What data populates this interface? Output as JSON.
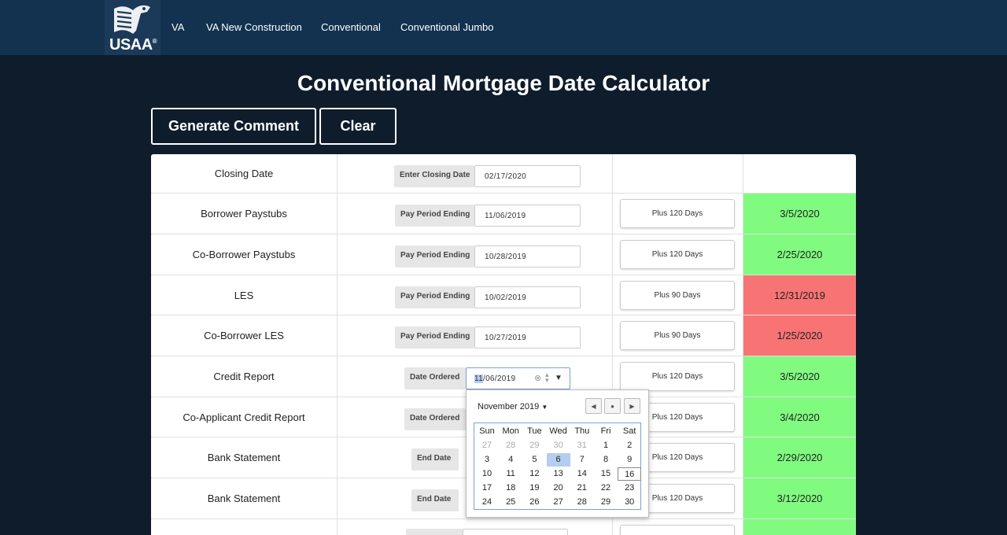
{
  "nav": {
    "logo_text": "USAA",
    "logo_mark": "®",
    "links": [
      "VA",
      "VA New Construction",
      "Conventional",
      "Conventional Jumbo"
    ]
  },
  "page": {
    "title": "Conventional Mortgage Date Calculator"
  },
  "actions": {
    "generate": "Generate Comment",
    "clear": "Clear"
  },
  "rows": [
    {
      "name": "Closing Date",
      "label": "Enter Closing Date",
      "value": "02/17/2020",
      "plus": "",
      "result": ""
    },
    {
      "name": "Borrower Paystubs",
      "label": "Pay Period Ending",
      "value": "11/06/2019",
      "plus": "Plus 120 Days",
      "result": "3/5/2020",
      "status": "green"
    },
    {
      "name": "Co-Borrower Paystubs",
      "label": "Pay Period Ending",
      "value": "10/28/2019",
      "plus": "Plus 120 Days",
      "result": "2/25/2020",
      "status": "green"
    },
    {
      "name": "LES",
      "label": "Pay Period Ending",
      "value": "10/02/2019",
      "plus": "Plus 90 Days",
      "result": "12/31/2019",
      "status": "red"
    },
    {
      "name": "Co-Borrower LES",
      "label": "Pay Period Ending",
      "value": "10/27/2019",
      "plus": "Plus 90 Days",
      "result": "1/25/2020",
      "status": "red"
    },
    {
      "name": "Credit Report",
      "label": "Date Ordered",
      "value_month": "11",
      "value_rest": "/06/2019",
      "plus": "Plus 120 Days",
      "result": "3/5/2020",
      "status": "green"
    },
    {
      "name": "Co-Applicant Credit Report",
      "label": "Date Ordered",
      "value": "",
      "plus": "Plus 120 Days",
      "result": "3/4/2020",
      "status": "green"
    },
    {
      "name": "Bank Statement",
      "label": "End Date",
      "value": "",
      "plus": "Plus 120 Days",
      "result": "2/29/2020",
      "status": "green"
    },
    {
      "name": "Bank Statement",
      "label": "End Date",
      "value": "",
      "plus": "Plus 120 Days",
      "result": "3/12/2020",
      "status": "green"
    }
  ],
  "calendar": {
    "month_label": "November 2019",
    "weekdays": [
      "Sun",
      "Mon",
      "Tue",
      "Wed",
      "Thu",
      "Fri",
      "Sat"
    ],
    "weeks": [
      [
        "27",
        "28",
        "29",
        "30",
        "31",
        "1",
        "2"
      ],
      [
        "3",
        "4",
        "5",
        "6",
        "7",
        "8",
        "9"
      ],
      [
        "10",
        "11",
        "12",
        "13",
        "14",
        "15",
        "16"
      ],
      [
        "17",
        "18",
        "19",
        "20",
        "21",
        "22",
        "23"
      ],
      [
        "24",
        "25",
        "26",
        "27",
        "28",
        "29",
        "30"
      ]
    ],
    "muted_days": [
      "27",
      "28",
      "29",
      "30",
      "31"
    ],
    "selected_day": "6",
    "today_day": "16"
  },
  "colors": {
    "green": "#80fb80",
    "red": "#f87474",
    "background": "#0e1c2c",
    "nav": "#12324f"
  }
}
